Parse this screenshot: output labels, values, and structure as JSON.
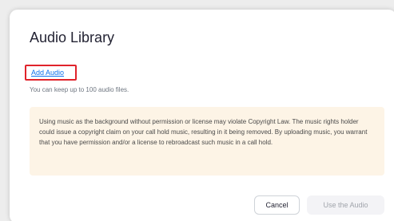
{
  "dialog": {
    "title": "Audio Library",
    "add_audio_link": "Add Audio",
    "subtext": "You can keep up to 100 audio files.",
    "warning_text": "Using music as the background without permission or license may violate Copyright Law. The music rights holder could issue a copyright claim on your call hold music, resulting in it being removed. By uploading music, you warrant that you have permission and/or a license to rebroadcast such music in a call hold.",
    "cancel_label": "Cancel",
    "use_label": "Use the Audio"
  },
  "colors": {
    "link": "#0e72ed",
    "highlight_border": "#e0232b",
    "warning_bg": "#fdf4e6",
    "disabled_text": "#a0a4ab"
  }
}
